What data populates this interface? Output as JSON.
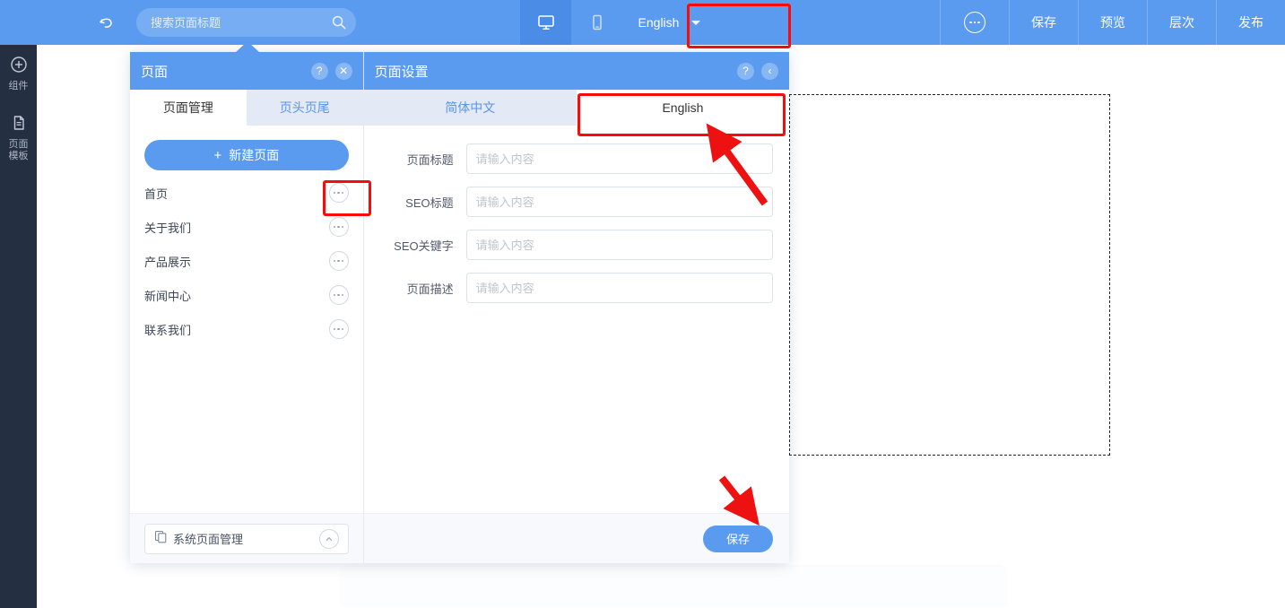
{
  "toolbar": {
    "undo_icon": "undo-arrow-icon",
    "search": {
      "placeholder": "搜索页面标题",
      "value": "",
      "icon": "search-icon"
    },
    "device_desktop_icon": "desktop-monitor-icon",
    "device_mobile_icon": "mobile-phone-icon",
    "language": {
      "selected": "English",
      "chevron_icon": "chevron-down-icon"
    },
    "more_icon": "more-dots-icon",
    "actions": [
      "保存",
      "预览",
      "层次",
      "发布"
    ]
  },
  "rail": {
    "items": [
      {
        "icon": "plus-circle-icon",
        "label": "组件"
      },
      {
        "icon": "document-icon",
        "label": "页面\n模板"
      }
    ],
    "item0_label": "组件",
    "item1_label_line1": "页面",
    "item1_label_line2": "模板"
  },
  "page_panel": {
    "title": "页面",
    "help_icon": "question-mark-icon",
    "close_icon": "close-x-icon",
    "tabs": [
      {
        "label": "页面管理",
        "active": true
      },
      {
        "label": "页头页尾",
        "active": false
      }
    ],
    "tab0_label": "页面管理",
    "tab1_label": "页头页尾",
    "new_page_button": "新建页面",
    "new_page_plus": "+",
    "pages": [
      {
        "name": "首页",
        "menu_icon": "more-dots-icon",
        "highlighted": true
      },
      {
        "name": "关于我们",
        "menu_icon": "more-dots-icon",
        "highlighted": false
      },
      {
        "name": "产品展示",
        "menu_icon": "more-dots-icon",
        "highlighted": false
      },
      {
        "name": "新闻中心",
        "menu_icon": "more-dots-icon",
        "highlighted": false
      },
      {
        "name": "联系我们",
        "menu_icon": "more-dots-icon",
        "highlighted": false
      }
    ],
    "footer": {
      "label": "系统页面管理",
      "left_icon": "pages-copy-icon",
      "collapse_icon": "chevron-up-icon"
    }
  },
  "settings_panel": {
    "title": "页面设置",
    "help_icon": "question-mark-icon",
    "back_icon": "chevron-left-icon",
    "tabs": [
      {
        "label": "简体中文",
        "active": false
      },
      {
        "label": "English",
        "active": true
      }
    ],
    "tab0_label": "简体中文",
    "tab1_label": "English",
    "fields": [
      {
        "label": "页面标题",
        "value": "",
        "placeholder": "请输入内容"
      },
      {
        "label": "SEO标题",
        "value": "",
        "placeholder": "请输入内容"
      },
      {
        "label": "SEO关键字",
        "value": "",
        "placeholder": "请输入内容"
      },
      {
        "label": "页面描述",
        "value": "",
        "placeholder": "请输入内容"
      }
    ],
    "save_button": "保存"
  },
  "annotations": {
    "highlight_color": "#fb0a0a",
    "arrow_color": "#ee1111",
    "boxes": [
      "language-selector",
      "english-tab",
      "first-page-menu"
    ],
    "arrows": [
      "arrow-to-english-tab",
      "arrow-to-save-button"
    ]
  },
  "colors": {
    "brand_blue": "#5a9bf0",
    "rail_dark": "#242f42",
    "tab_inactive_bg": "#e3eaf5",
    "panel_footer_bg": "#f7f9fc"
  }
}
